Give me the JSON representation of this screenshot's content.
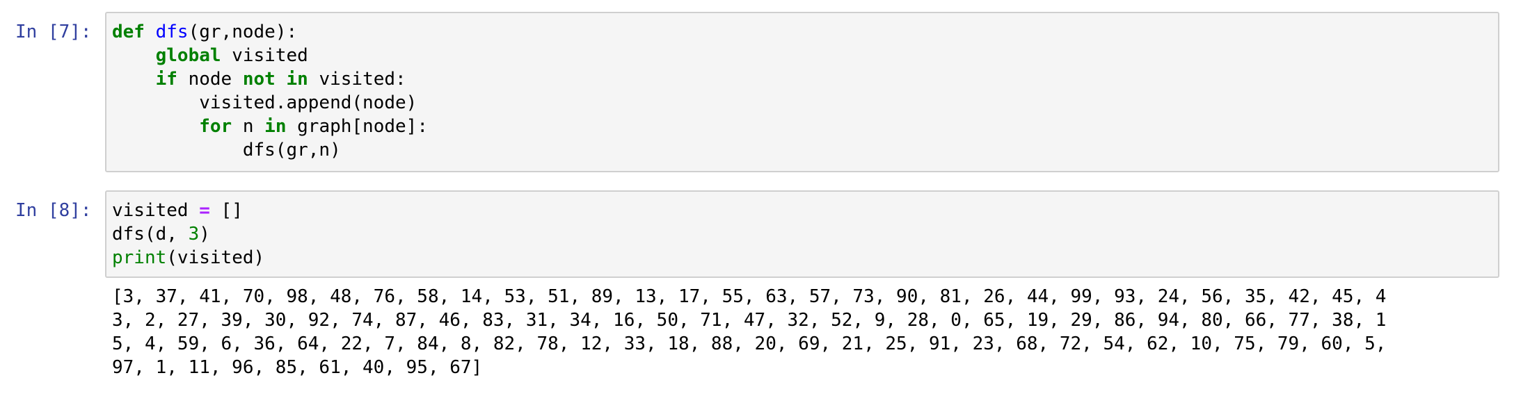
{
  "cells": [
    {
      "prompt": "In [7]:",
      "code": {
        "l1": {
          "kw": "def",
          "sp": " ",
          "fn": "dfs",
          "rest": "(gr,node):"
        },
        "l2": {
          "indent": "    ",
          "kw": "global",
          "rest": " visited"
        },
        "l3": {
          "indent": "    ",
          "kw1": "if",
          "mid1": " node ",
          "kw2": "not",
          "mid2": " ",
          "kw3": "in",
          "rest": " visited:"
        },
        "l4": {
          "text": "        visited.append(node)"
        },
        "l5": {
          "indent": "        ",
          "kw1": "for",
          "mid1": " n ",
          "kw2": "in",
          "rest": " graph[node]:"
        },
        "l6": {
          "text": "            dfs(gr,n)"
        }
      }
    },
    {
      "prompt": "In [8]:",
      "code": {
        "l1": {
          "pre": "visited ",
          "op": "=",
          "post": " []"
        },
        "l2": {
          "pre": "dfs(d, ",
          "num": "3",
          "post": ")"
        },
        "l3": {
          "builtin": "print",
          "post": "(visited)"
        }
      },
      "output_lines": [
        "[3, 37, 41, 70, 98, 48, 76, 58, 14, 53, 51, 89, 13, 17, 55, 63, 57, 73, 90, 81, 26, 44, 99, 93, 24, 56, 35, 42, 45, 4",
        "3, 2, 27, 39, 30, 92, 74, 87, 46, 83, 31, 34, 16, 50, 71, 47, 32, 52, 9, 28, 0, 65, 19, 29, 86, 94, 80, 66, 77, 38, 1",
        "5, 4, 59, 6, 36, 64, 22, 7, 84, 8, 82, 78, 12, 33, 18, 88, 20, 69, 21, 25, 91, 23, 68, 72, 54, 62, 10, 75, 79, 60, 5,",
        "97, 1, 11, 96, 85, 61, 40, 95, 67]"
      ]
    }
  ],
  "colors": {
    "prompt": "#303f9f",
    "keyword": "#008000",
    "function_name": "#0000ff",
    "operator": "#aa22ff",
    "cell_background": "#f5f5f5",
    "cell_border": "#cfcfcf"
  }
}
